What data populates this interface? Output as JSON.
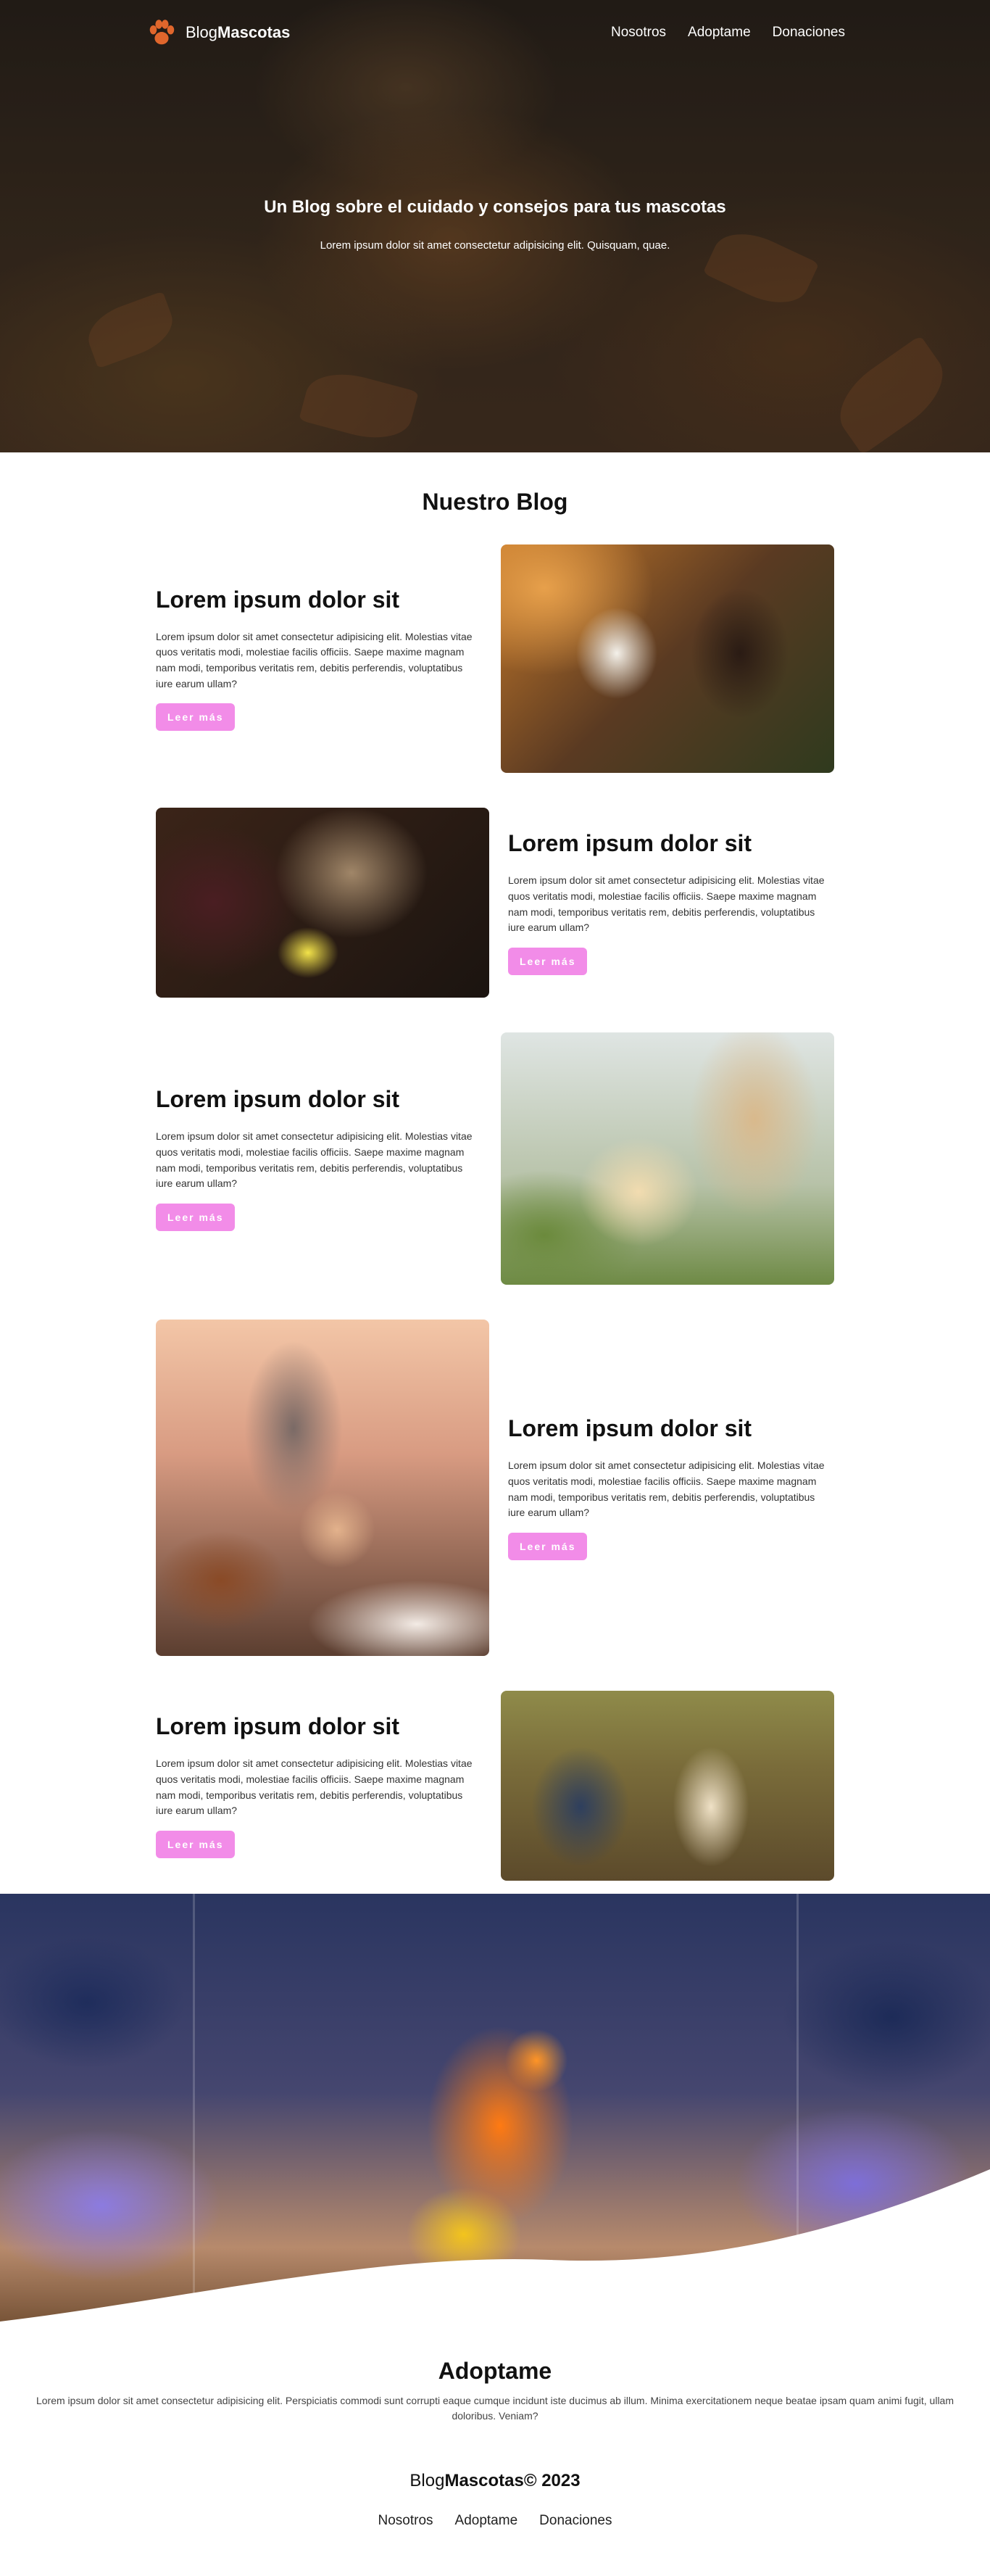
{
  "colors": {
    "accent": "#f28ce8",
    "logo_paw": "#e0662c",
    "hero_text": "#ffffff",
    "heading": "#111111"
  },
  "header": {
    "logo": {
      "icon": "paw-icon",
      "text_regular": "Blog",
      "text_bold": "Mascotas"
    },
    "nav": [
      "Nosotros",
      "Adoptame",
      "Donaciones"
    ]
  },
  "hero": {
    "title": "Un Blog sobre el cuidado y consejos para tus mascotas",
    "subtitle": "Lorem ipsum dolor sit amet consectetur adipisicing elit. Quisquam, quae."
  },
  "blog": {
    "title": "Nuestro Blog",
    "posts": [
      {
        "title": "Lorem ipsum dolor sit",
        "text": "Lorem ipsum dolor sit amet consectetur adipisicing elit. Molestias vitae quos veritatis modi, molestiae facilis officiis. Saepe maxime magnam nam modi, temporibus veritatis rem, debitis perferendis, voluptatibus iure earum ullam?",
        "button": "Leer más"
      },
      {
        "title": "Lorem ipsum dolor sit",
        "text": "Lorem ipsum dolor sit amet consectetur adipisicing elit. Molestias vitae quos veritatis modi, molestiae facilis officiis. Saepe maxime magnam nam modi, temporibus veritatis rem, debitis perferendis, voluptatibus iure earum ullam?",
        "button": "Leer más"
      },
      {
        "title": "Lorem ipsum dolor sit",
        "text": "Lorem ipsum dolor sit amet consectetur adipisicing elit. Molestias vitae quos veritatis modi, molestiae facilis officiis. Saepe maxime magnam nam modi, temporibus veritatis rem, debitis perferendis, voluptatibus iure earum ullam?",
        "button": "Leer más"
      },
      {
        "title": "Lorem ipsum dolor sit",
        "text": "Lorem ipsum dolor sit amet consectetur adipisicing elit. Molestias vitae quos veritatis modi, molestiae facilis officiis. Saepe maxime magnam nam modi, temporibus veritatis rem, debitis perferendis, voluptatibus iure earum ullam?",
        "button": "Leer más"
      },
      {
        "title": "Lorem ipsum dolor sit",
        "text": "Lorem ipsum dolor sit amet consectetur adipisicing elit. Molestias vitae quos veritatis modi, molestiae facilis officiis. Saepe maxime magnam nam modi, temporibus veritatis rem, debitis perferendis, voluptatibus iure earum ullam?",
        "button": "Leer más"
      }
    ]
  },
  "adopt": {
    "title": "Adoptame",
    "text": "Lorem ipsum dolor sit amet consectetur adipisicing elit. Perspiciatis commodi sunt corrupti eaque cumque incidunt iste ducimus ab illum. Minima exercitationem neque beatae ipsam quam animi fugit, ullam doloribus. Veniam?"
  },
  "footer": {
    "brand_regular": "Blog",
    "brand_bold": "Mascotas",
    "copyright": "© 2023",
    "nav": [
      "Nosotros",
      "Adoptame",
      "Donaciones"
    ]
  }
}
